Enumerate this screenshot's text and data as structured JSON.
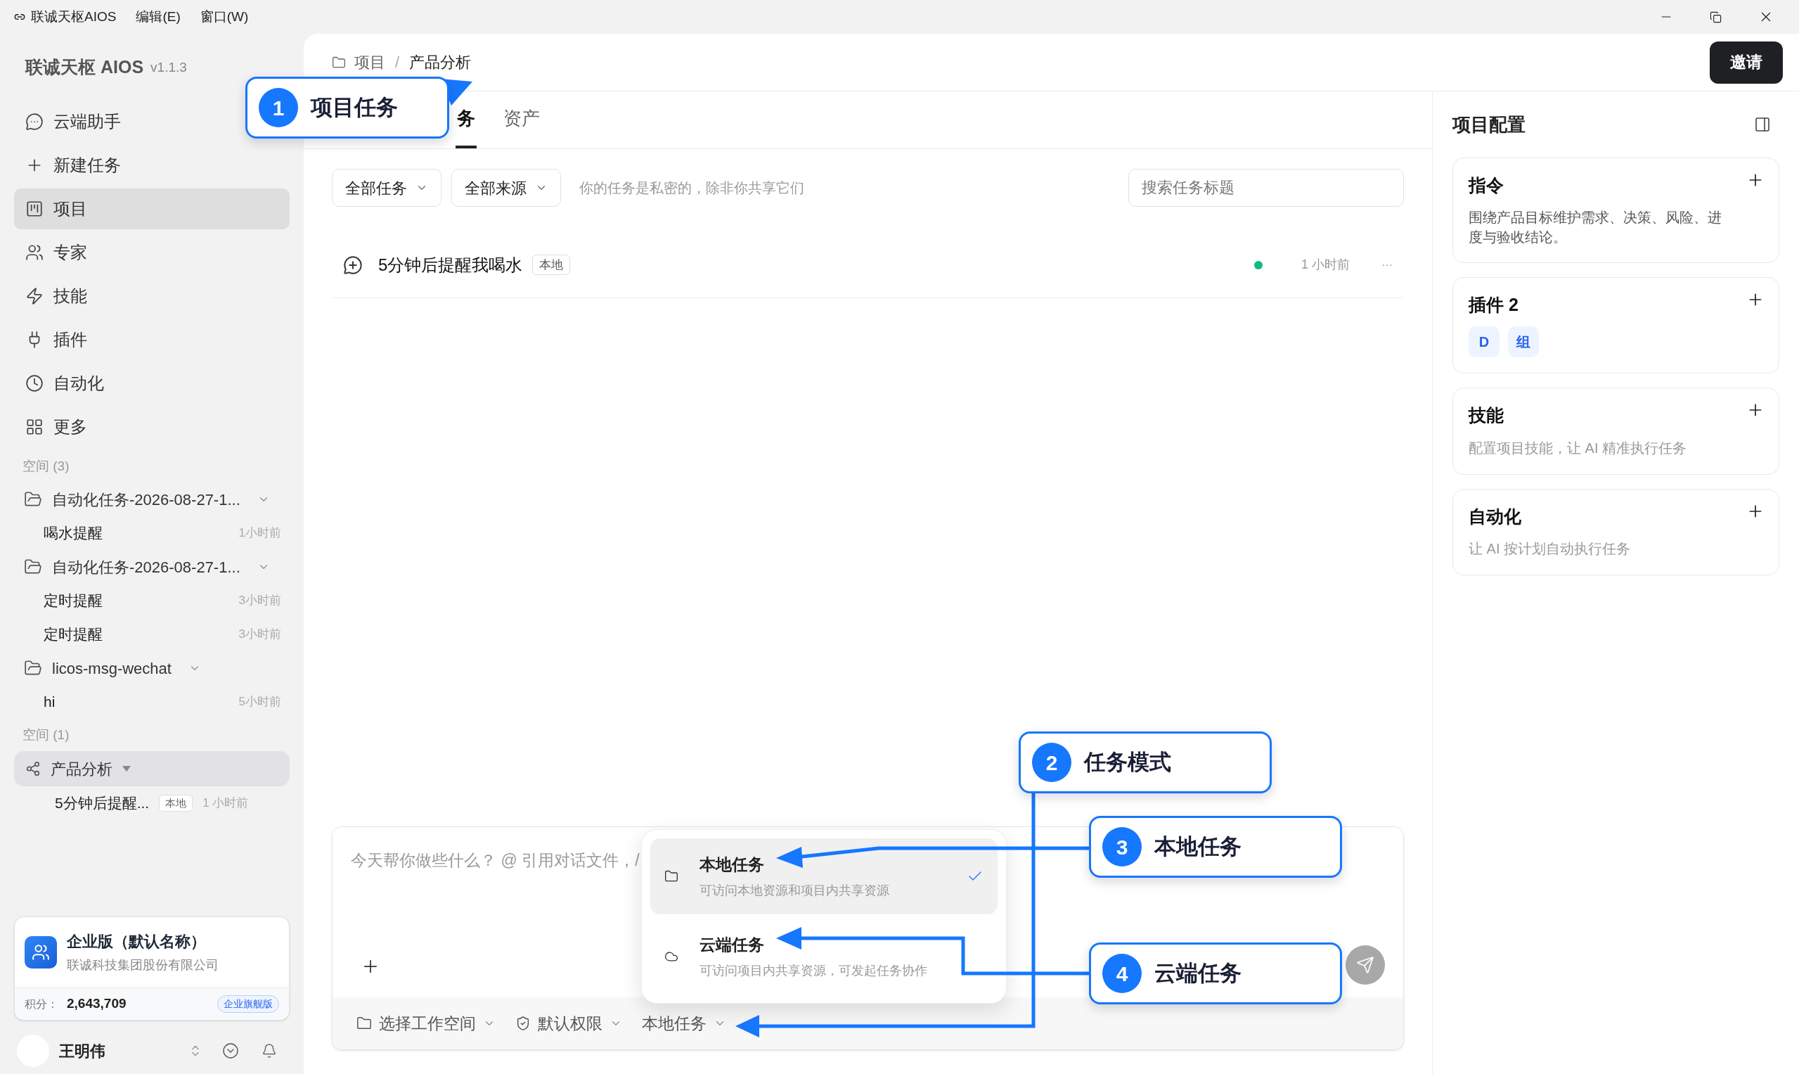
{
  "titlebar": {
    "app": "联诚天枢AIOS",
    "menus": [
      "编辑(E)",
      "窗口(W)"
    ]
  },
  "sidebar": {
    "brand": "联诚天枢 AIOS",
    "version": "v1.1.3",
    "nav": [
      {
        "label": "云端助手",
        "selected": false
      },
      {
        "label": "新建任务",
        "selected": false
      },
      {
        "label": "项目",
        "selected": true
      },
      {
        "label": "专家",
        "selected": false
      },
      {
        "label": "技能",
        "selected": false
      },
      {
        "label": "插件",
        "selected": false
      },
      {
        "label": "自动化",
        "selected": false
      },
      {
        "label": "更多",
        "selected": false
      }
    ],
    "spaces": [
      {
        "label": "空间 (3)",
        "groups": [
          {
            "kind": "folder",
            "name": "自动化任务-2026-08-27-1...",
            "selected": false,
            "children": [
              {
                "title": "喝水提醒",
                "time": "1小时前"
              }
            ]
          },
          {
            "kind": "folder",
            "name": "自动化任务-2026-08-27-1...",
            "selected": false,
            "children": [
              {
                "title": "定时提醒",
                "time": "3小时前"
              },
              {
                "title": "定时提醒",
                "time": "3小时前"
              }
            ]
          },
          {
            "kind": "folder",
            "name": "licos-msg-wechat",
            "selected": false,
            "children": [
              {
                "title": "hi",
                "time": "5小时前"
              }
            ]
          }
        ]
      },
      {
        "label": "空间 (1)",
        "groups": [
          {
            "kind": "project",
            "name": "产品分析",
            "selected": true,
            "children": [
              {
                "title": "5分钟后提醒...",
                "badge": "本地",
                "time": "1 小时前"
              }
            ]
          }
        ]
      }
    ],
    "org": {
      "name": "企业版（默认名称）",
      "company": "联诚科技集团股份有限公司",
      "points_label": "积分：",
      "points": "2,643,709",
      "plan": "企业旗舰版"
    },
    "user": {
      "name": "王明伟"
    }
  },
  "header": {
    "breadcrumb": [
      "项目",
      "产品分析"
    ],
    "separator": "/",
    "invite": "邀请"
  },
  "tabs": [
    {
      "label": "务",
      "selected": true
    },
    {
      "label": "资产",
      "selected": false
    }
  ],
  "filters": {
    "dropdowns": [
      "全部任务",
      "全部来源"
    ],
    "hint": "你的任务是私密的，除非你共享它们",
    "search_placeholder": "搜索任务标题"
  },
  "tasks": [
    {
      "title": "5分钟后提醒我喝水",
      "badge": "本地",
      "color": "#10b981",
      "time": "1 小时前",
      "more": "···"
    }
  ],
  "composer": {
    "placeholder": "今天帮你做些什么？ @ 引用对话文件，/",
    "toolbar": [
      "选择工作空间",
      "默认权限",
      "本地任务"
    ]
  },
  "mode_menu": [
    {
      "kind": "local",
      "title": "本地任务",
      "description": "可访问本地资源和项目内共享资源",
      "selected": true
    },
    {
      "kind": "cloud",
      "title": "云端任务",
      "description": "可访问项目内共享资源，可发起任务协作",
      "selected": false
    }
  ],
  "config": {
    "title": "项目配置",
    "cards": [
      {
        "kind": "text",
        "title": "指令",
        "text": "围绕产品目标维护需求、决策、风险、进度与验收结论。"
      },
      {
        "kind": "chips",
        "title": "插件 2",
        "chips": [
          "D",
          "组"
        ]
      },
      {
        "kind": "hint",
        "title": "技能",
        "text": "配置项目技能，让 AI 精准执行任务"
      },
      {
        "kind": "hint",
        "title": "自动化",
        "text": "让 AI 按计划自动执行任务"
      }
    ]
  },
  "annotations": [
    {
      "number": "1",
      "label": "项目任务"
    },
    {
      "number": "2",
      "label": "任务模式"
    },
    {
      "number": "3",
      "label": "本地任务"
    },
    {
      "number": "4",
      "label": "云端任务"
    }
  ]
}
